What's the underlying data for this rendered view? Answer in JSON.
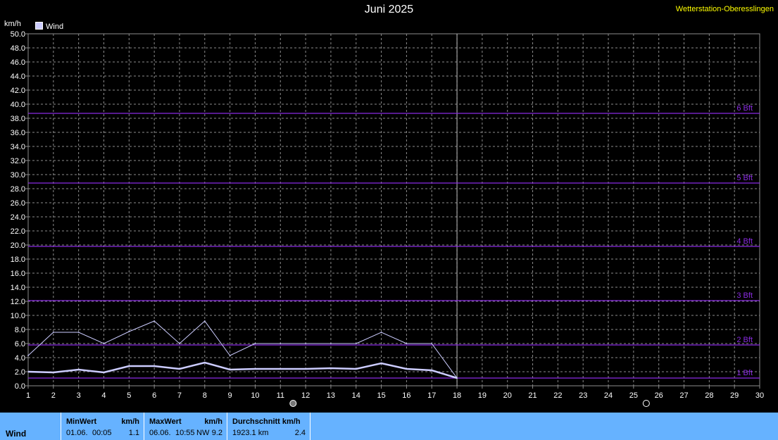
{
  "header": {
    "title": "Juni 2025",
    "station": "Wetterstation-Oberesslingen",
    "unit": "km/h",
    "legend": "Wind"
  },
  "colors": {
    "background": "#000000",
    "grid": "#8c8c8c",
    "series": "#ccccff",
    "beaufort": "#8a2be2",
    "title": "#ffffff",
    "station": "#ffff00",
    "footer": "#66b2ff"
  },
  "chart_data": {
    "type": "line",
    "title": "Juni 2025",
    "ylabel": "km/h",
    "xlim": [
      1,
      30
    ],
    "ylim": [
      0,
      50
    ],
    "y_tick_step": 2,
    "x_ticks": [
      1,
      2,
      3,
      4,
      5,
      6,
      7,
      8,
      9,
      10,
      11,
      12,
      13,
      14,
      15,
      16,
      17,
      18,
      19,
      20,
      21,
      22,
      23,
      24,
      25,
      26,
      27,
      28,
      29,
      30
    ],
    "grid": true,
    "legend": "top-left",
    "current_day": 18,
    "series": [
      {
        "name": "Wind",
        "role": "max",
        "x": [
          1,
          2,
          3,
          4,
          5,
          6,
          7,
          8,
          9,
          10,
          11,
          12,
          13,
          14,
          15,
          16,
          17,
          18
        ],
        "values": [
          4.3,
          7.6,
          7.6,
          6.0,
          7.7,
          9.2,
          6.0,
          9.2,
          4.3,
          6.0,
          6.0,
          6.0,
          6.0,
          6.0,
          7.6,
          6.0,
          6.0,
          1.1
        ]
      },
      {
        "name": "Wind",
        "role": "average",
        "x": [
          1,
          2,
          3,
          4,
          5,
          6,
          7,
          8,
          9,
          10,
          11,
          12,
          13,
          14,
          15,
          16,
          17,
          18
        ],
        "values": [
          2.0,
          1.9,
          2.3,
          1.9,
          2.8,
          2.8,
          2.4,
          3.3,
          2.3,
          2.4,
          2.4,
          2.4,
          2.5,
          2.4,
          3.2,
          2.4,
          2.2,
          1.1
        ]
      }
    ],
    "thresholds": [
      {
        "label": "1 Bft",
        "value": 1.1
      },
      {
        "label": "2 Bft",
        "value": 5.8
      },
      {
        "label": "3 Bft",
        "value": 12.1
      },
      {
        "label": "4 Bft",
        "value": 19.8
      },
      {
        "label": "5 Bft",
        "value": 28.8
      },
      {
        "label": "6 Bft",
        "value": 38.7
      }
    ],
    "moon_markers": [
      {
        "day": 11,
        "icon": "full-moon-icon"
      },
      {
        "day": 25,
        "icon": "new-moon-icon"
      }
    ]
  },
  "footer": {
    "label": "Wind",
    "min": {
      "header": "MinWert",
      "unit": "km/h",
      "date": "01.06.",
      "time": "00:05",
      "value": "1.1"
    },
    "max": {
      "header": "MaxWert",
      "unit": "km/h",
      "date": "06.06.",
      "time": "10:55",
      "dir": "NW",
      "value": "9.2"
    },
    "avg": {
      "header": "Durchschnitt km/h",
      "distance": "1923.1 km",
      "value": "2.4"
    }
  }
}
